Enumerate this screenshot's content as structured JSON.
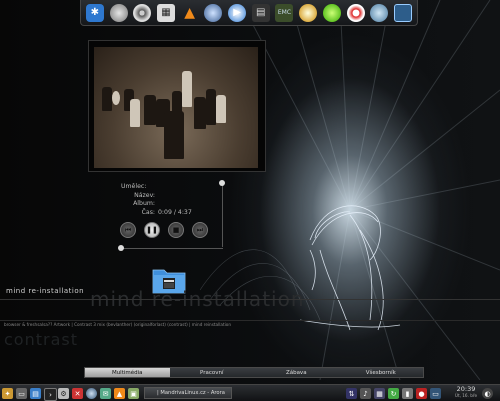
{
  "desktop": {
    "left_label": "mind re-installation",
    "big_label": "mind re-installation",
    "ticker": "browser & freshsalsa?? Artwork | Contrast 3 mix (bevlanther) (originalforlast) (contrast) | mind reinstallation",
    "contrast_label": "contrast"
  },
  "dock": {
    "icons": [
      "kde-menu-icon",
      "disc-icon",
      "optical-drive-icon",
      "film-icon",
      "vlc-cone-icon",
      "audio-player-icon",
      "media-player-icon",
      "clapper-icon",
      "emc-icon",
      "disc-burner-icon",
      "green-app-icon",
      "eye-icon",
      "globe-icon",
      "monitor-icon"
    ]
  },
  "player": {
    "artist_label": "Umělec:",
    "title_label": "Název:",
    "album_label": "Album:",
    "time_label": "Čas:",
    "artist": "",
    "title": "",
    "album": "",
    "time": "0:09 / 4:37"
  },
  "pager": {
    "tabs": [
      "Multimédia",
      "Pracovní",
      "Zábava",
      "Všesborník"
    ],
    "active": 0
  },
  "taskbar": {
    "task_label": "| MandrivaLinux.cz - Arora",
    "time": "20:39",
    "date": "Út, 16. bře"
  },
  "colors": {
    "accent": "#9ecbe8",
    "vlc": "#f08a1a",
    "kde": "#2e78d0"
  }
}
